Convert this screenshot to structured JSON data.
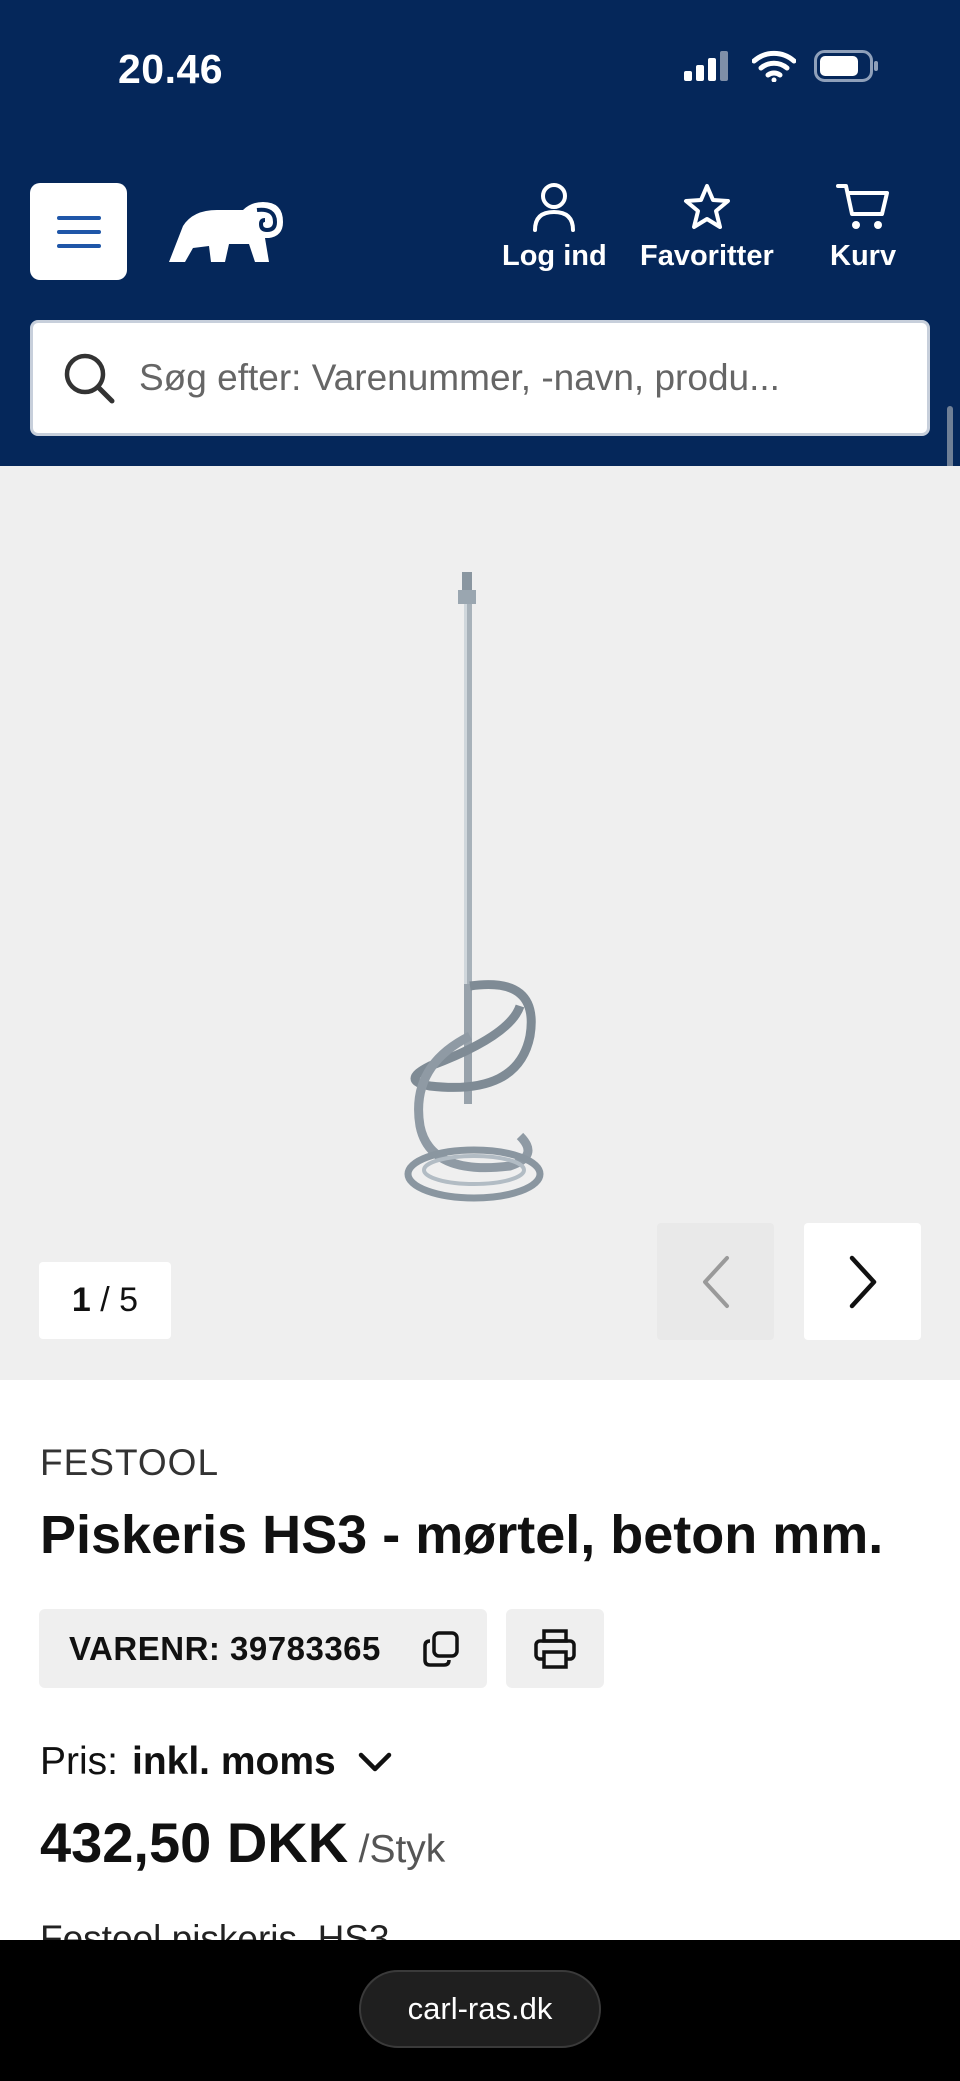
{
  "status_bar": {
    "time": "20.46"
  },
  "header": {
    "actions": [
      {
        "label": "Log ind",
        "icon": "user-icon"
      },
      {
        "label": "Favoritter",
        "icon": "star-icon"
      },
      {
        "label": "Kurv",
        "icon": "cart-icon"
      }
    ],
    "colors": {
      "header_bg": "#05275a",
      "accent": "#2a5aa0"
    }
  },
  "search": {
    "placeholder": "Søg efter: Varenummer, -navn, produ..."
  },
  "gallery": {
    "current": "1",
    "total": "/ 5"
  },
  "product": {
    "brand": "FESTOOL",
    "title": "Piskeris HS3 - mørtel, beton mm.",
    "sku_label": "VARENR: 39783365",
    "price_label": "Pris:",
    "price_mode": "inkl. moms",
    "price": "432,50 DKK",
    "unit": "/Styk",
    "description_start": "Festool piskeris, HS3"
  },
  "browser": {
    "url": "carl-ras.dk"
  }
}
